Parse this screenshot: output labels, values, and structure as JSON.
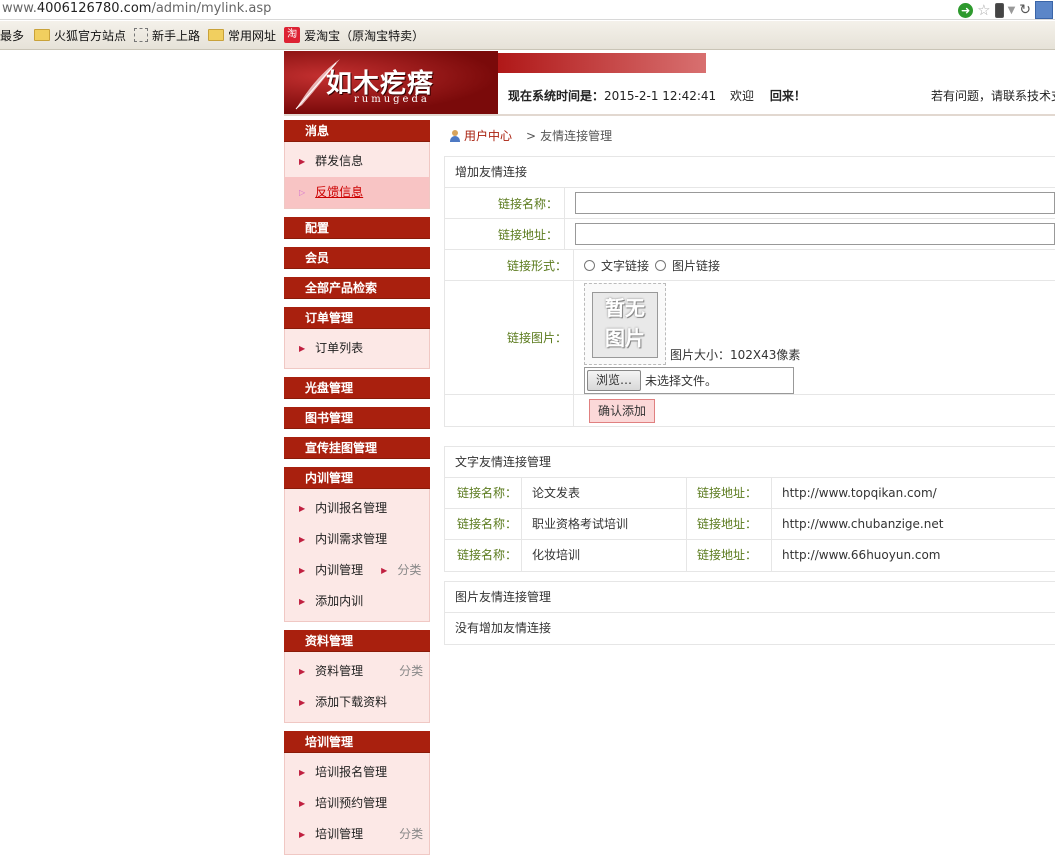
{
  "browser": {
    "url_prefix": "www.",
    "url_domain": "4006126780.com",
    "url_path": "/admin/mylink.asp"
  },
  "bookmarks": {
    "most": "最多",
    "items": [
      "火狐官方站点",
      "新手上路",
      "常用网址",
      "爱淘宝（原淘宝特卖）"
    ]
  },
  "header": {
    "logo_title": "如木疙瘩",
    "logo_sub": "rumugeda",
    "time_label": "现在系统时间是：",
    "time_value": "2015-2-1 12:42:41",
    "welcome": "欢迎",
    "welcome_back": "回来！",
    "help_text": "若有问题，请联系技术支"
  },
  "sidebar": {
    "message": "消息",
    "message_items": [
      "群发信息",
      "反馈信息"
    ],
    "config": "配置",
    "member": "会员",
    "product_search": "全部产品检索",
    "order_mgmt": "订单管理",
    "order_items": [
      "订单列表"
    ],
    "cd_mgmt": "光盘管理",
    "book_mgmt": "图书管理",
    "poster_mgmt": "宣传挂图管理",
    "internal_training": "内训管理",
    "internal_items": [
      "内训报名管理",
      "内训需求管理",
      "内训管理",
      "添加内训"
    ],
    "category": "分类",
    "material_mgmt": "资料管理",
    "material_items": [
      "资料管理",
      "添加下载资料"
    ],
    "training_mgmt": "培训管理",
    "training_items": [
      "培训报名管理",
      "培训预约管理",
      "培训管理"
    ]
  },
  "breadcrumb": {
    "home": "用户中心",
    "sep": ">",
    "current": "友情连接管理"
  },
  "add_form": {
    "title": "增加友情连接",
    "name_label": "链接名称：",
    "url_label": "链接地址：",
    "type_label": "链接形式：",
    "type_text": "文字链接",
    "type_image": "图片链接",
    "image_label": "链接图片：",
    "noimg_line1": "暂无",
    "noimg_line2": "图片",
    "image_size": "图片大小：102X43像素",
    "browse": "浏览…",
    "no_file": "未选择文件。",
    "submit": "确认添加"
  },
  "text_links": {
    "title": "文字友情连接管理",
    "name_label": "链接名称：",
    "url_label": "链接地址：",
    "rows": [
      {
        "name": "论文发表",
        "url": "http://www.topqikan.com/"
      },
      {
        "name": "职业资格考试培训",
        "url": "http://www.chubanzige.net"
      },
      {
        "name": "化妆培训",
        "url": "http://www.66huoyun.com"
      }
    ]
  },
  "image_links": {
    "title": "图片友情连接管理",
    "empty": "没有增加友情连接"
  }
}
